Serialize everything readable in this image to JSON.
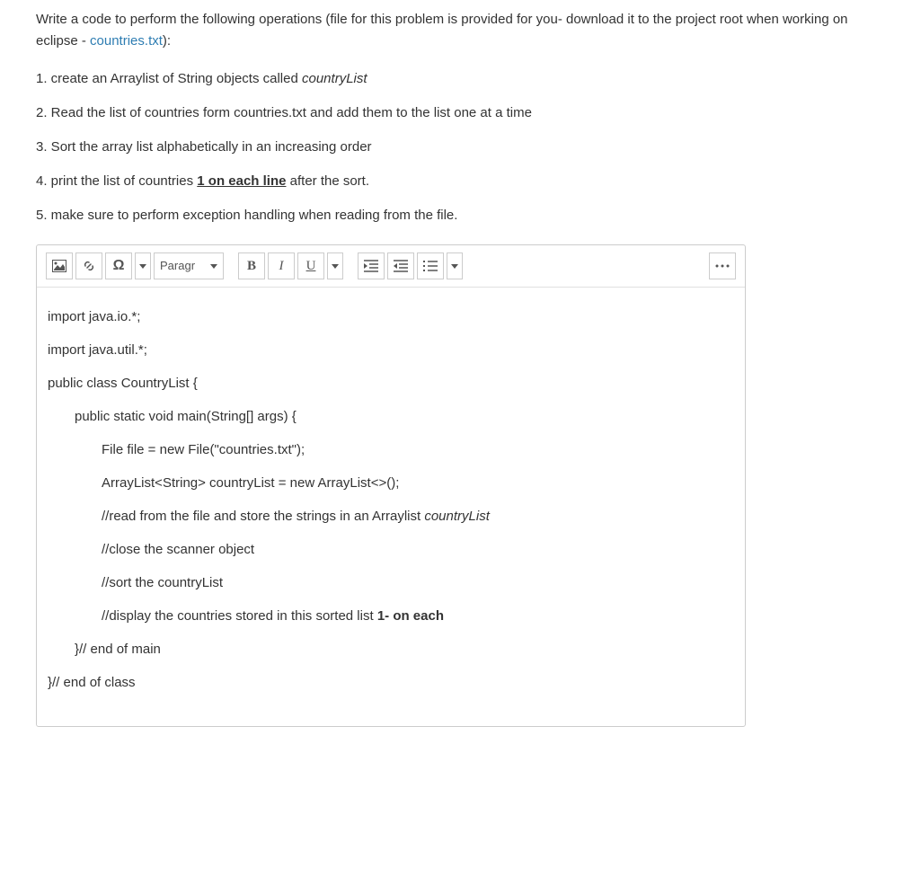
{
  "problem": {
    "intro_part1": "Write a code to perform the following operations (file for this problem is provided for you- download it to the project root when working on eclipse - ",
    "intro_link": "countries.txt",
    "intro_part2": "):",
    "steps": [
      {
        "num": "1.",
        "text_a": " create an Arraylist of String objects called ",
        "italic": "countryList"
      },
      {
        "num": "2.",
        "text_a": " Read the list of countries form countries.txt and add them to the list one at a time"
      },
      {
        "num": "3.",
        "text_a": " Sort the array list alphabetically in an increasing order"
      },
      {
        "num": "4.",
        "text_a": " print the list of countries ",
        "emphasis": "1 on each line",
        "text_b": " after the sort."
      },
      {
        "num": "5.",
        "text_a": " make sure to perform exception handling when reading from the file."
      }
    ]
  },
  "toolbar": {
    "paragraph_label": "Paragr",
    "bold_label": "B",
    "italic_label": "I",
    "underline_label": "U",
    "omega_label": "Ω"
  },
  "editor": {
    "lines": {
      "l1": "import java.io.*;",
      "l2": "import java.util.*;",
      "l3": "public class CountryList {",
      "l4": "public static void main(String[] args) {",
      "l5": "File file = new File(\"countries.txt\");",
      "l6": "ArrayList<String> countryList = new ArrayList<>();",
      "l7_a": "//read from the file and store the strings in an Arraylist ",
      "l7_b": "countryList",
      "l8": "//close the scanner object",
      "l9": "//sort the countryList",
      "l10_a": "//display the countries stored in this sorted list ",
      "l10_b": "1- on each",
      "l11": "}// end of main",
      "l12": "}// end of class"
    }
  }
}
